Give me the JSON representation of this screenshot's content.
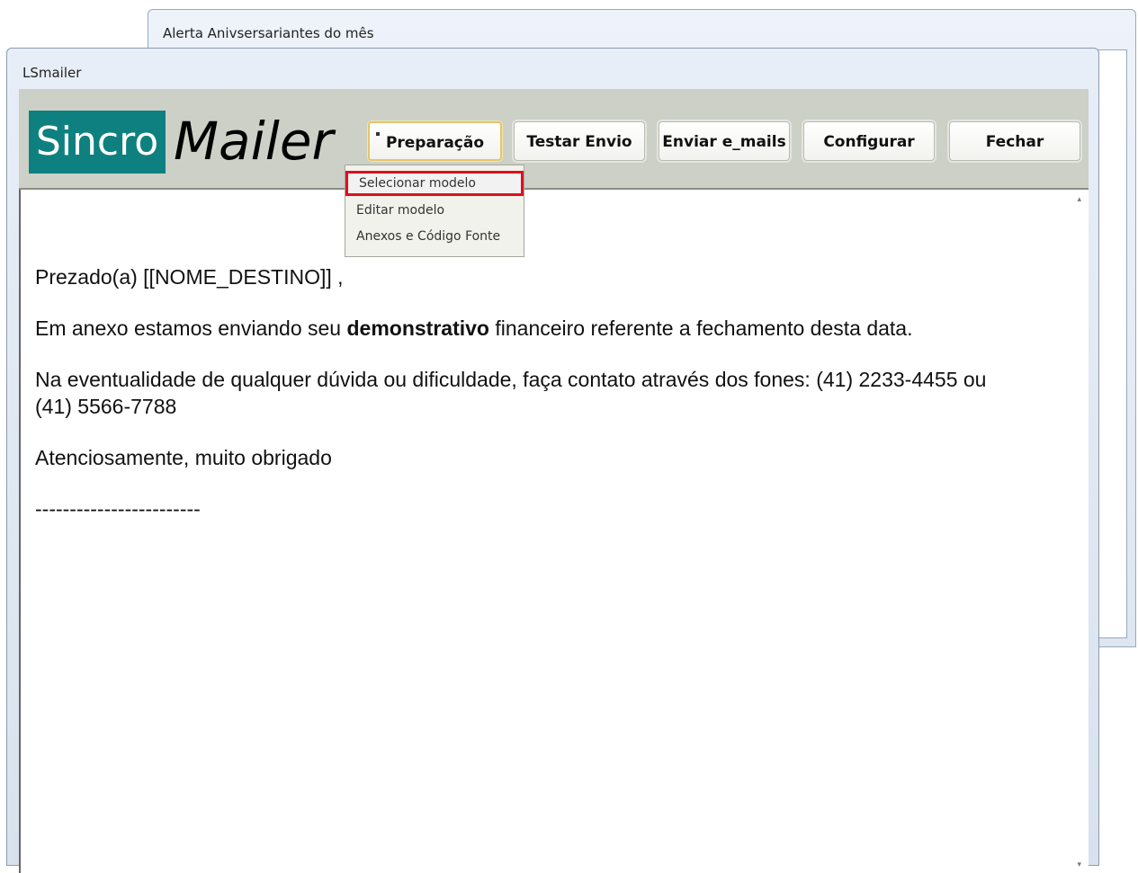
{
  "background_window": {
    "title": "Alerta Anivsersariantes do mês"
  },
  "main_window": {
    "title": "LSmailer"
  },
  "logo": {
    "box_text": "Sincro",
    "text": "Mailer"
  },
  "toolbar": {
    "buttons": [
      {
        "label": "Preparação",
        "active": true
      },
      {
        "label": "Testar Envio"
      },
      {
        "label": "Enviar e_mails"
      },
      {
        "label": "Configurar"
      },
      {
        "label": "Fechar"
      }
    ]
  },
  "menu": {
    "items": [
      {
        "label": "Selecionar modelo",
        "highlighted": true
      },
      {
        "label": "Editar modelo"
      },
      {
        "label": "Anexos e Código Fonte"
      }
    ]
  },
  "letter": {
    "greeting": "Prezado(a)  [[NOME_DESTINO]] ,",
    "body1_pre": "Em anexo estamos enviando seu ",
    "body1_bold": "demonstrativo",
    "body1_post": " financeiro referente a fechamento desta data.",
    "body2_line1": "Na eventualidade de qualquer dúvida ou dificuldade, faça contato através dos fones: (41) 2233-4455  ou",
    "body2_line2": " (41) 5566-7788",
    "closing": "Atenciosamente, muito obrigado",
    "separator": "------------------------"
  },
  "colors": {
    "logo_bg": "#0f8080",
    "toolbar_bg": "#cdd0c7",
    "highlight_border": "#e0101c"
  }
}
